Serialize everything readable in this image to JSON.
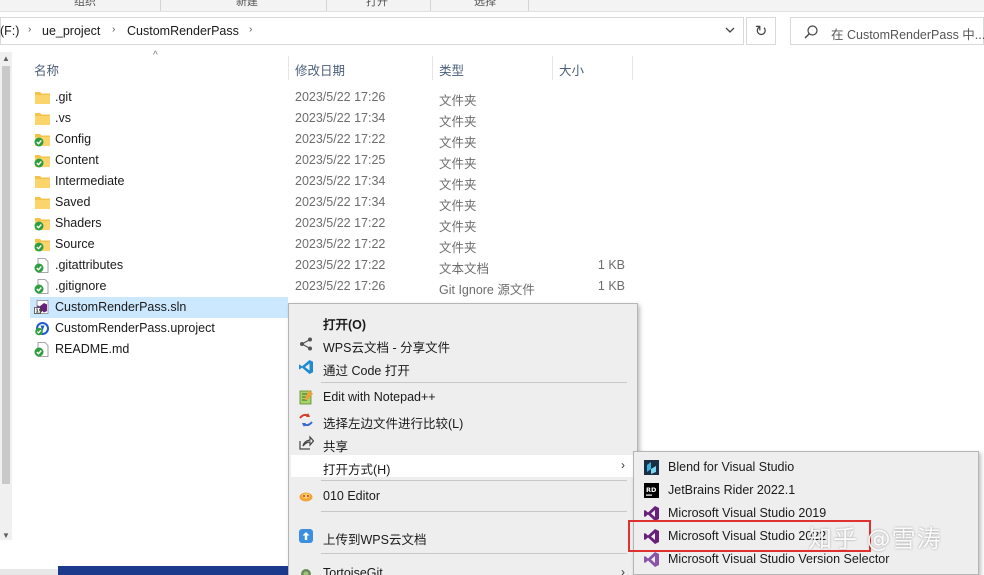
{
  "ribbon": {
    "items": [
      "组织",
      "新建",
      "打开",
      "选择"
    ]
  },
  "address": {
    "drive": "(F:)",
    "crumbs": [
      "ue_project",
      "CustomRenderPass"
    ]
  },
  "search": {
    "placeholder": "在 CustomRenderPass 中..."
  },
  "columns": {
    "name": "名称",
    "date": "修改日期",
    "type": "类型",
    "size": "大小"
  },
  "files": [
    {
      "name": ".git",
      "date": "2023/5/22 17:26",
      "type": "文件夹",
      "size": "",
      "icon": "folder-icon"
    },
    {
      "name": ".vs",
      "date": "2023/5/22 17:34",
      "type": "文件夹",
      "size": "",
      "icon": "folder-icon"
    },
    {
      "name": "Config",
      "date": "2023/5/22 17:22",
      "type": "文件夹",
      "size": "",
      "icon": "folder-git-ok-icon"
    },
    {
      "name": "Content",
      "date": "2023/5/22 17:25",
      "type": "文件夹",
      "size": "",
      "icon": "folder-git-ok-icon"
    },
    {
      "name": "Intermediate",
      "date": "2023/5/22 17:34",
      "type": "文件夹",
      "size": "",
      "icon": "folder-icon"
    },
    {
      "name": "Saved",
      "date": "2023/5/22 17:34",
      "type": "文件夹",
      "size": "",
      "icon": "folder-icon"
    },
    {
      "name": "Shaders",
      "date": "2023/5/22 17:22",
      "type": "文件夹",
      "size": "",
      "icon": "folder-git-ok-icon"
    },
    {
      "name": "Source",
      "date": "2023/5/22 17:22",
      "type": "文件夹",
      "size": "",
      "icon": "folder-git-ok-icon"
    },
    {
      "name": ".gitattributes",
      "date": "2023/5/22 17:22",
      "type": "文本文档",
      "size": "1 KB",
      "icon": "file-git-ok-icon"
    },
    {
      "name": ".gitignore",
      "date": "2023/5/22 17:26",
      "type": "Git Ignore 源文件",
      "size": "1 KB",
      "icon": "file-git-ok-icon"
    },
    {
      "name": "CustomRenderPass.sln",
      "date": "",
      "type": "",
      "size": "",
      "icon": "sln-file-icon",
      "selected": true
    },
    {
      "name": "CustomRenderPass.uproject",
      "date": "",
      "type": "",
      "size": "",
      "icon": "uproject-file-icon"
    },
    {
      "name": "README.md",
      "date": "",
      "type": "",
      "size": "",
      "icon": "file-git-ok-icon"
    }
  ],
  "context_menu": {
    "open": "打开(O)",
    "wps_share": "WPS云文档 - 分享文件",
    "open_code": "通过 Code 打开",
    "notepad": "Edit with Notepad++",
    "compare": "选择左边文件进行比较(L)",
    "share": "共享",
    "open_with": "打开方式(H)",
    "editor010": "010 Editor",
    "upload_wps": "上传到WPS云文档",
    "tortoise": "TortoiseGit"
  },
  "open_with_menu": [
    {
      "label": "Blend for Visual Studio",
      "icon": "blend-icon"
    },
    {
      "label": "JetBrains Rider 2022.1",
      "icon": "rider-icon"
    },
    {
      "label": "Microsoft Visual Studio 2019",
      "icon": "visual-studio-icon"
    },
    {
      "label": "Microsoft Visual Studio 2022",
      "icon": "visual-studio-icon"
    },
    {
      "label": "Microsoft Visual Studio Version Selector",
      "icon": "visual-studio-icon"
    }
  ],
  "watermark": "知乎 @雪涛",
  "colors": {
    "selection": "#cce8ff",
    "highlight": "#e03131",
    "folder": "#f5c24c",
    "git_ok": "#2e9e3e",
    "vs_purple": "#68217a"
  }
}
